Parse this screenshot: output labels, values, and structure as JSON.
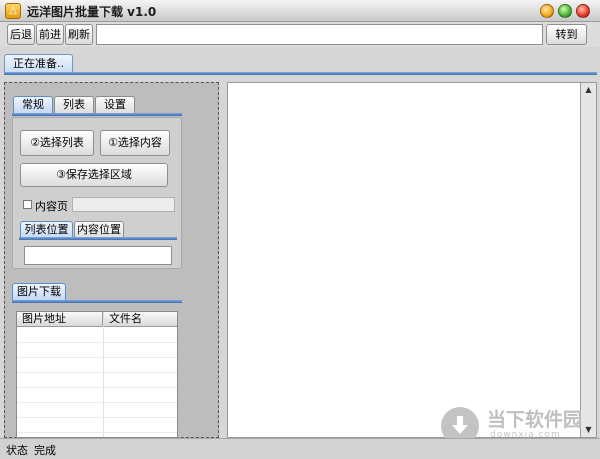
{
  "window": {
    "title": "远洋图片批量下载 v1.0",
    "app_icon_glyph": "△"
  },
  "toolbar": {
    "back_label": "后退",
    "forward_label": "前进",
    "refresh_label": "刷新",
    "url_value": "",
    "go_label": "转到"
  },
  "browser_tab": {
    "label": "正在准备.."
  },
  "tabs": [
    "常规",
    "列表",
    "设置"
  ],
  "general": {
    "select_list_label": "②选择列表",
    "select_content_label": "①选择内容",
    "save_region_label": "③保存选择区域",
    "content_page_label": "内容页",
    "content_page_checked": false,
    "content_page_value": ""
  },
  "position_tabs": [
    "列表位置",
    "内容位置"
  ],
  "position_value": "",
  "download": {
    "tab_label": "图片下载",
    "columns": [
      "图片地址",
      "文件名"
    ],
    "rows": []
  },
  "status": {
    "label": "状态",
    "value": "完成"
  },
  "watermark": {
    "title": "当下软件园",
    "url": "downxia.com"
  },
  "colors": {
    "accent_blue": "#3d6db3",
    "tab_active_bg": "#c4d9f4"
  }
}
